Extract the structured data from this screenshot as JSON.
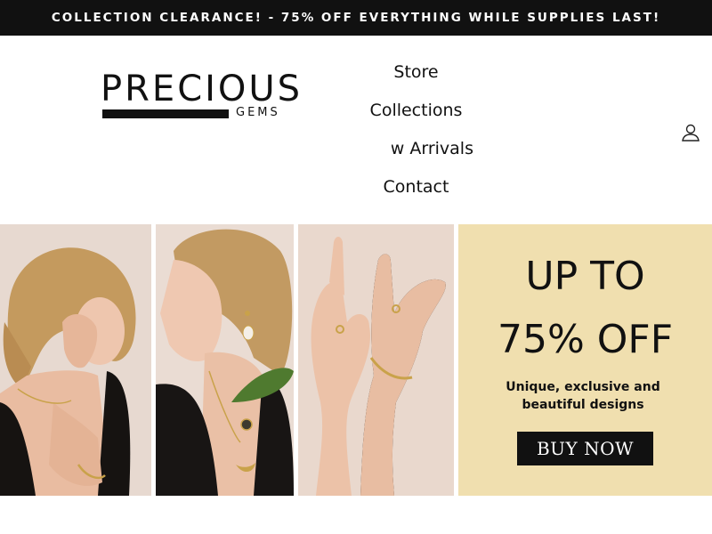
{
  "announcement": {
    "text": "COLLECTION CLEARANCE! - 75% OFF EVERYTHING WHILE SUPPLIES LAST!"
  },
  "logo": {
    "main": "PRECIOUS",
    "sub": "GEMS"
  },
  "nav": {
    "items": [
      {
        "label": "Store"
      },
      {
        "label": "Collections"
      },
      {
        "label": "New Arrivals"
      },
      {
        "label": "Contact"
      }
    ]
  },
  "header": {
    "account_icon": "user-icon"
  },
  "hero": {
    "photos": [
      "model-hair-hand-photo",
      "model-earring-necklace-photo",
      "hands-rings-bracelet-photo"
    ],
    "promo": {
      "line1": "UP TO",
      "line2": "75% OFF",
      "subtitle": "Unique, exclusive and beautiful designs",
      "button_label": "BUY NOW",
      "background": "#f0dfaf"
    }
  },
  "colors": {
    "announce_bg": "#111111",
    "text": "#111111",
    "promo_bg": "#f0dfaf"
  }
}
